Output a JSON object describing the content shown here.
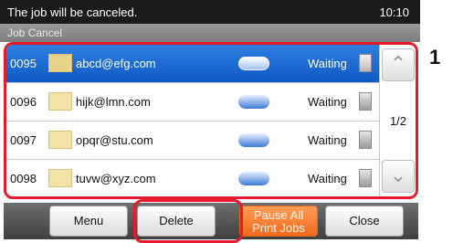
{
  "header": {
    "message": "The job will be canceled.",
    "time": "10:10",
    "subtitle": "Job Cancel"
  },
  "jobs": [
    {
      "number": "0095",
      "destination": "abcd@efg.com",
      "status": "Waiting",
      "selected": true
    },
    {
      "number": "0096",
      "destination": "hijk@lmn.com",
      "status": "Waiting",
      "selected": false
    },
    {
      "number": "0097",
      "destination": "opqr@stu.com",
      "status": "Waiting",
      "selected": false
    },
    {
      "number": "0098",
      "destination": "tuvw@xyz.com",
      "status": "Waiting",
      "selected": false
    }
  ],
  "pager": {
    "page_indicator": "1/2",
    "up_icon": "chevron-up-icon",
    "down_icon": "chevron-down-icon"
  },
  "callout_number": "1",
  "buttons": {
    "menu": "Menu",
    "delete": "Delete",
    "pause_line1": "Pause All",
    "pause_line2": "Print Jobs",
    "close": "Close"
  },
  "colors": {
    "selected_row": "#1a6ad6",
    "highlight_frame": "#e8192c",
    "pause_button": "#f47a2a",
    "header_bg": "#1a1a1a"
  }
}
